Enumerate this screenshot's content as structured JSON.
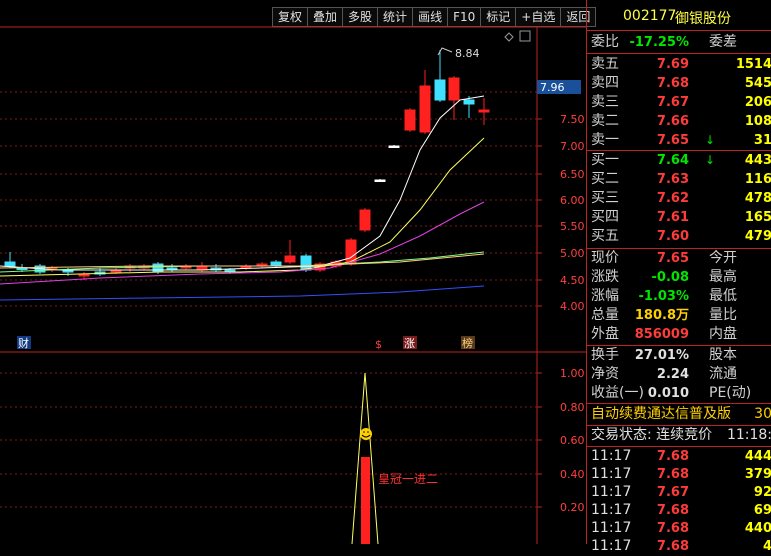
{
  "toolbar": [
    "复权",
    "叠加",
    "多股",
    "统计",
    "画线",
    "F10",
    "标记",
    "+自选",
    "返回"
  ],
  "chart": {
    "price_ticks": [
      "7.50",
      "7.00",
      "6.50",
      "6.00",
      "5.50",
      "5.00",
      "4.50",
      "4.00"
    ],
    "price_flag": "7.96",
    "high_label": "8.84",
    "vol_ticks": [
      "1.00",
      "0.80",
      "0.60",
      "0.40",
      "0.20"
    ],
    "badges": {
      "cai": "财",
      "dollar": "$",
      "zhang": "涨",
      "bang": "榜"
    },
    "indicator_label": "皇冠一进二",
    "smile": "☺"
  },
  "stock": {
    "code": "002177",
    "name": "御银股份"
  },
  "weibi": {
    "label": "委比",
    "value": "-17.25%",
    "label2": "委差"
  },
  "asks": [
    {
      "label": "卖五",
      "price": "7.69",
      "vol": "1514"
    },
    {
      "label": "卖四",
      "price": "7.68",
      "vol": "545"
    },
    {
      "label": "卖三",
      "price": "7.67",
      "vol": "206"
    },
    {
      "label": "卖二",
      "price": "7.66",
      "vol": "108"
    },
    {
      "label": "卖一",
      "price": "7.65",
      "arrow": "↓",
      "vol": "31"
    }
  ],
  "bids": [
    {
      "label": "买一",
      "price": "7.64",
      "arrow": "↓",
      "vol": "443"
    },
    {
      "label": "买二",
      "price": "7.63",
      "vol": "116"
    },
    {
      "label": "买三",
      "price": "7.62",
      "vol": "478"
    },
    {
      "label": "买四",
      "price": "7.61",
      "vol": "165"
    },
    {
      "label": "买五",
      "price": "7.60",
      "vol": "479"
    }
  ],
  "quote": [
    {
      "l1": "现价",
      "v1": "7.65",
      "c1": "red",
      "l2": "今开"
    },
    {
      "l1": "涨跌",
      "v1": "-0.08",
      "c1": "grn",
      "l2": "最高"
    },
    {
      "l1": "涨幅",
      "v1": "-1.03%",
      "c1": "grn",
      "l2": "最低"
    },
    {
      "l1": "总量",
      "v1": "180.8万",
      "c1": "yel",
      "l2": "量比"
    },
    {
      "l1": "外盘",
      "v1": "856009",
      "c1": "red",
      "l2": "内盘"
    }
  ],
  "fund": [
    {
      "l1": "换手",
      "v1": "27.01%",
      "l2": "股本"
    },
    {
      "l1": "净资",
      "v1": "2.24",
      "l2": "流通"
    },
    {
      "l1": "收益(一)",
      "v1": "0.010",
      "l2": "PE(动)"
    }
  ],
  "ticker": {
    "text": "自动续费通达信普及版",
    "num": "30"
  },
  "status": {
    "text": "交易状态: 连续竞价",
    "time": "11:18:"
  },
  "trades": [
    {
      "time": "11:17",
      "price": "7.68",
      "vol": "444"
    },
    {
      "time": "11:17",
      "price": "7.68",
      "vol": "379"
    },
    {
      "time": "11:17",
      "price": "7.67",
      "vol": "92"
    },
    {
      "time": "11:17",
      "price": "7.68",
      "vol": "69"
    },
    {
      "time": "11:17",
      "price": "7.68",
      "vol": "440"
    },
    {
      "time": "11:17",
      "price": "7.68",
      "vol": "4"
    }
  ]
}
